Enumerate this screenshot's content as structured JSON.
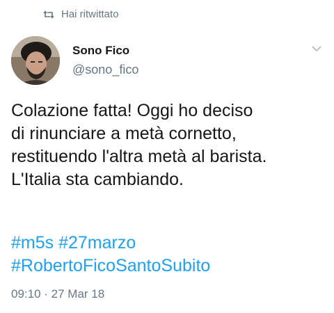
{
  "retweet": {
    "icon": "retweet-icon",
    "label": "Hai ritwittato"
  },
  "author": {
    "name": "Sono Fico",
    "handle": "@sono_fico",
    "avatar": "avatar-photo"
  },
  "menu": {
    "icon": "chevron-down-icon"
  },
  "tweet": {
    "lines": [
      "Colazione fatta! Oggi ho deciso",
      "di rinunciare a metà cornetto,",
      "restituendo l'altra metà al barista.",
      "L'Italia sta cambiando."
    ],
    "hashtags": [
      "#m5s",
      "#27marzo",
      "#RobertoFicoSantoSubito"
    ],
    "timestamp": "09:10 · 27 Mar 18"
  },
  "colors": {
    "text": "#14171a",
    "secondary": "#657786",
    "link": "#1da1f2"
  }
}
